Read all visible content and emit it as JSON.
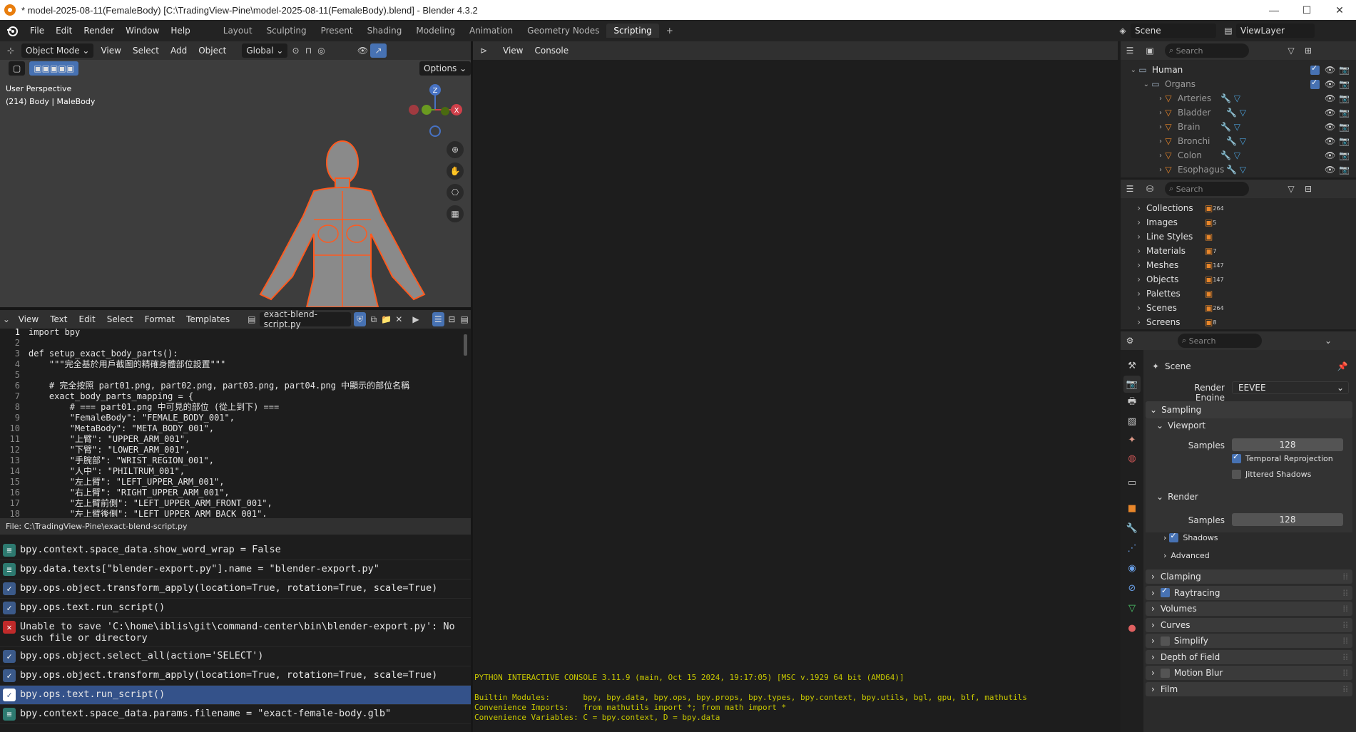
{
  "window": {
    "title": "* model-2025-08-11(FemaleBody) [C:\\TradingView-Pine\\model-2025-08-11(FemaleBody).blend] - Blender 4.3.2",
    "minimize": "—",
    "maximize": "☐",
    "close": "✕"
  },
  "menu": [
    "File",
    "Edit",
    "Render",
    "Window",
    "Help"
  ],
  "workspaces": [
    "Layout",
    "Sculpting",
    "Present",
    "Shading",
    "Modeling",
    "Geometry Nodes",
    "Scripting",
    "Animation"
  ],
  "workspaces_order": [
    "Layout",
    "Sculpting",
    "Present",
    "Shading",
    "Modeling",
    "Animation",
    "Geometry Nodes",
    "Scripting"
  ],
  "active_workspace": "Scripting",
  "scene_name": "Scene",
  "viewlayer_name": "ViewLayer",
  "viewport": {
    "mode": "Object Mode",
    "menus": [
      "View",
      "Select",
      "Add",
      "Object"
    ],
    "orientation": "Global",
    "options": "Options",
    "perspective": "User Perspective",
    "object_info": "(214) Body | MaleBody",
    "gizmo": {
      "z": "Z",
      "x": "X"
    }
  },
  "text_editor": {
    "menus": [
      "View",
      "Text",
      "Edit",
      "Select",
      "Format",
      "Templates"
    ],
    "filename": "exact-blend-script.py",
    "file_path": "File: C:\\TradingView-Pine\\exact-blend-script.py",
    "lines": [
      {
        "n": "1",
        "code": "import bpy"
      },
      {
        "n": "2",
        "code": ""
      },
      {
        "n": "3",
        "code": "def setup_exact_body_parts():"
      },
      {
        "n": "4",
        "code": "    \"\"\"完全基於用戶截圖的精確身體部位設置\"\"\""
      },
      {
        "n": "5",
        "code": ""
      },
      {
        "n": "6",
        "code": "    # 完全按照 part01.png, part02.png, part03.png, part04.png 中顯示的部位名稱"
      },
      {
        "n": "7",
        "code": "    exact_body_parts_mapping = {"
      },
      {
        "n": "8",
        "code": "        # === part01.png 中可見的部位 (從上到下) ==="
      },
      {
        "n": "9",
        "code": "        \"FemaleBody\": \"FEMALE_BODY_001\","
      },
      {
        "n": "10",
        "code": "        \"MetaBody\": \"META_BODY_001\","
      },
      {
        "n": "11",
        "code": "        \"上臂\": \"UPPER_ARM_001\","
      },
      {
        "n": "12",
        "code": "        \"下臂\": \"LOWER_ARM_001\","
      },
      {
        "n": "13",
        "code": "        \"手腕部\": \"WRIST_REGION_001\","
      },
      {
        "n": "14",
        "code": "        \"人中\": \"PHILTRUM_001\","
      },
      {
        "n": "15",
        "code": "        \"左上臂\": \"LEFT_UPPER_ARM_001\","
      },
      {
        "n": "16",
        "code": "        \"右上臂\": \"RIGHT_UPPER_ARM_001\","
      },
      {
        "n": "17",
        "code": "        \"左上臂前側\": \"LEFT_UPPER_ARM_FRONT_001\","
      },
      {
        "n": "18",
        "code": "        \"左上臂後側\": \"LEFT_UPPER_ARM_BACK_001\","
      }
    ]
  },
  "info_log": [
    {
      "type": "info",
      "text": "bpy.context.space_data.show_word_wrap = False"
    },
    {
      "type": "info",
      "text": "bpy.data.texts[\"blender-export.py\"].name = \"blender-export.py\""
    },
    {
      "type": "ok",
      "text": "bpy.ops.object.transform_apply(location=True, rotation=True, scale=True)"
    },
    {
      "type": "ok",
      "text": "bpy.ops.text.run_script()"
    },
    {
      "type": "error",
      "text": "Unable to save 'C:\\home\\iblis\\git\\command-center\\bin\\blender-export.py': No such file or directory"
    },
    {
      "type": "ok",
      "text": "bpy.ops.object.select_all(action='SELECT')"
    },
    {
      "type": "ok",
      "text": "bpy.ops.object.transform_apply(location=True, rotation=True, scale=True)"
    },
    {
      "type": "ok-sel",
      "text": "bpy.ops.text.run_script()"
    },
    {
      "type": "info",
      "text": "bpy.context.space_data.params.filename = \"exact-female-body.glb\""
    }
  ],
  "console": {
    "menus": [
      "View",
      "Console"
    ],
    "banner": "PYTHON INTERACTIVE CONSOLE 3.11.9 (main, Oct 15 2024, 19:17:05) [MSC v.1929 64 bit (AMD64)]",
    "builtin": "Builtin Modules:       bpy, bpy.data, bpy.ops, bpy.props, bpy.types, bpy.context, bpy.utils, bgl, gpu, blf, mathutils",
    "imports": "Convenience Imports:   from mathutils import *; from math import *",
    "variables": "Convenience Variables: C = bpy.context, D = bpy.data"
  },
  "outliner": {
    "search_placeholder": "Search",
    "items": [
      {
        "label": "Human",
        "indent": 0,
        "color": "#e6e6e6"
      },
      {
        "label": "Organs",
        "indent": 1,
        "color": "#9a9a9a"
      },
      {
        "label": "Arteries",
        "indent": 2,
        "color": "#9a9a9a"
      },
      {
        "label": "Bladder",
        "indent": 2,
        "color": "#9a9a9a"
      },
      {
        "label": "Brain",
        "indent": 2,
        "color": "#9a9a9a"
      },
      {
        "label": "Bronchi",
        "indent": 2,
        "color": "#9a9a9a"
      },
      {
        "label": "Colon",
        "indent": 2,
        "color": "#9a9a9a"
      },
      {
        "label": "Esophagus",
        "indent": 2,
        "color": "#9a9a9a"
      }
    ]
  },
  "blend_file": {
    "search_placeholder": "Search",
    "items": [
      {
        "label": "Collections",
        "count": "264"
      },
      {
        "label": "Images",
        "count": "5"
      },
      {
        "label": "Line Styles",
        "count": ""
      },
      {
        "label": "Materials",
        "count": "7"
      },
      {
        "label": "Meshes",
        "count": "147"
      },
      {
        "label": "Objects",
        "count": "147"
      },
      {
        "label": "Palettes",
        "count": ""
      },
      {
        "label": "Scenes",
        "count": "264"
      },
      {
        "label": "Screens",
        "count": "8"
      }
    ]
  },
  "properties": {
    "search_placeholder": "Search",
    "title": "Scene",
    "render_engine_label": "Render Engine",
    "render_engine": "EEVEE",
    "sampling": "Sampling",
    "viewport": "Viewport",
    "samples_label": "Samples",
    "viewport_samples": "128",
    "temporal": "Temporal Reprojection",
    "jittered": "Jittered Shadows",
    "render": "Render",
    "render_samples": "128",
    "shadows": "Shadows",
    "advanced": "Advanced",
    "sections": [
      "Clamping",
      "Raytracing",
      "Volumes",
      "Curves",
      "Simplify",
      "Depth of Field",
      "Motion Blur",
      "Film"
    ]
  }
}
